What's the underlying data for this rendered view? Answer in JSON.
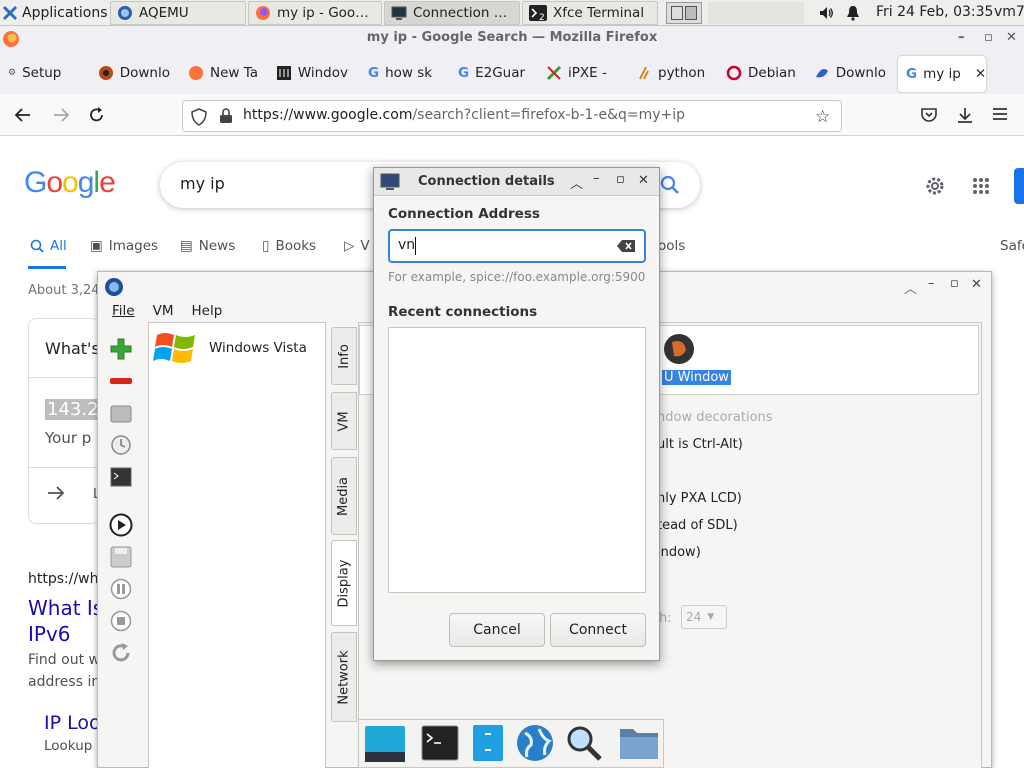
{
  "panel": {
    "applications": "Applications",
    "tasks": [
      "AQEMU",
      "my ip - Googl…",
      "Connection de…",
      "Xfce Terminal"
    ],
    "clock": "Fri 24 Feb, 03:35",
    "user": "vm7"
  },
  "firefox": {
    "title": "my ip - Google Search — Mozilla Firefox",
    "bookmarks": [
      "Setup",
      "Downlo",
      "New Ta",
      "Windov",
      "how sk",
      "E2Guar",
      "iPXE -",
      "python",
      "Debian",
      "Downlo",
      "my ip"
    ],
    "url_host": "https://www.google.com",
    "url_path": "/search?client=firefox-b-1-e&q=my+ip"
  },
  "google": {
    "logo": "Google",
    "query": "my ip",
    "tabs": [
      "All",
      "Images",
      "News",
      "Books",
      "V",
      "ools"
    ],
    "safe": "Safe",
    "about": "About 3,24",
    "card_title": "What's",
    "ip_fragment": "143.2",
    "ip_sub": "Your p",
    "card_link_frag": "L",
    "result_url": "https://wh",
    "result_title_1": "What Is",
    "result_title_2": "IPv6",
    "result_snip_1": "Find out w",
    "result_snip_2": "address in",
    "result2_title": "IP Loo",
    "result2_snip": "Lookup"
  },
  "aqemu": {
    "menu": [
      "File",
      "VM",
      "Help"
    ],
    "vm_name": "Windows Vista",
    "vtabs": [
      "Info",
      "VM",
      "Media",
      "Display",
      "Network"
    ],
    "window_label_frag": "U Window",
    "options": [
      "ndow decorations",
      "ult is Ctrl-Alt)",
      "nly PXA LCD)",
      "tead of SDL)",
      "indow)"
    ],
    "depth_label": "h:",
    "depth_value": "24"
  },
  "dialog": {
    "title": "Connection details",
    "address_label": "Connection Address",
    "address_value": "vn",
    "example": "For example, spice://foo.example.org:5900",
    "recent_label": "Recent connections",
    "cancel": "Cancel",
    "connect": "Connect"
  },
  "colors": {
    "google_blue": "#4285f4",
    "google_red": "#ea4335",
    "google_yellow": "#fbbc05",
    "google_green": "#34a853",
    "link": "#1a0dab",
    "focus": "#3584e4"
  }
}
